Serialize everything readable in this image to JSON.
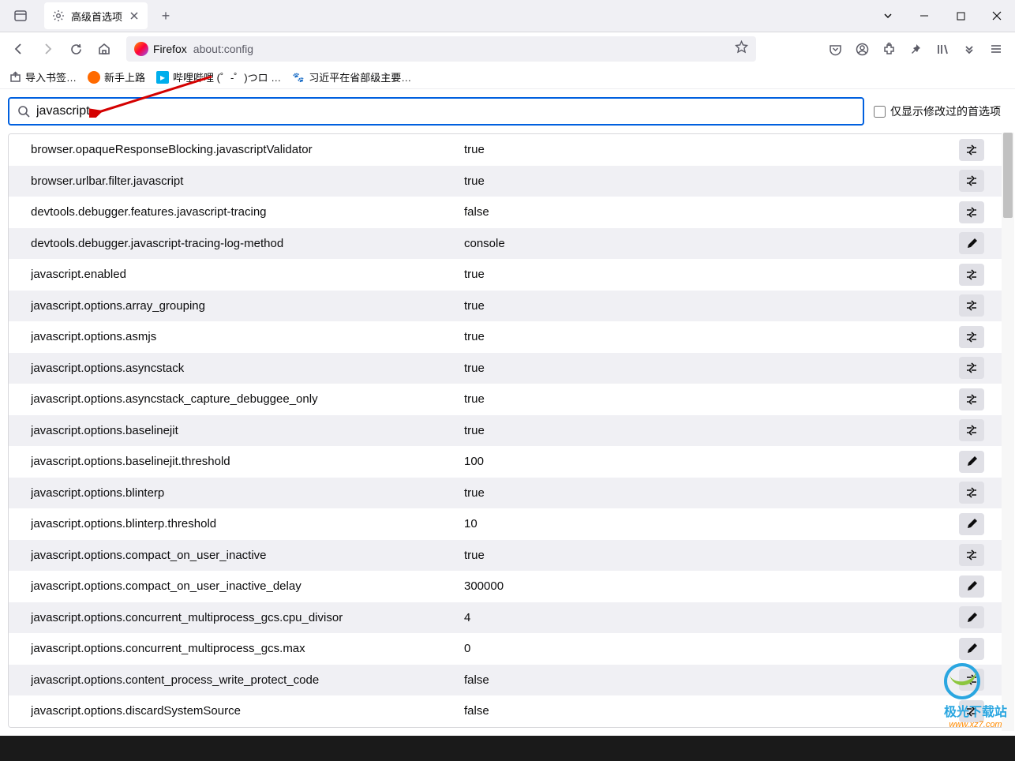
{
  "tab_title": "高级首选项",
  "urlbar_identity": "Firefox",
  "urlbar_url": "about:config",
  "bookmarks": [
    {
      "label": "导入书签…",
      "icon": "import"
    },
    {
      "label": "新手上路",
      "icon": "orange"
    },
    {
      "label": "哔哩哔哩 (゜-゜)つロ …",
      "icon": "cyan"
    },
    {
      "label": "习近平在省部级主要…",
      "icon": "paw"
    }
  ],
  "search_value": "javascript",
  "filter_label": "仅显示修改过的首选项",
  "prefs": [
    {
      "name": "browser.opaqueResponseBlocking.javascriptValidator",
      "value": "true",
      "action": "toggle"
    },
    {
      "name": "browser.urlbar.filter.javascript",
      "value": "true",
      "action": "toggle"
    },
    {
      "name": "devtools.debugger.features.javascript-tracing",
      "value": "false",
      "action": "toggle"
    },
    {
      "name": "devtools.debugger.javascript-tracing-log-method",
      "value": "console",
      "action": "edit"
    },
    {
      "name": "javascript.enabled",
      "value": "true",
      "action": "toggle"
    },
    {
      "name": "javascript.options.array_grouping",
      "value": "true",
      "action": "toggle"
    },
    {
      "name": "javascript.options.asmjs",
      "value": "true",
      "action": "toggle"
    },
    {
      "name": "javascript.options.asyncstack",
      "value": "true",
      "action": "toggle"
    },
    {
      "name": "javascript.options.asyncstack_capture_debuggee_only",
      "value": "true",
      "action": "toggle"
    },
    {
      "name": "javascript.options.baselinejit",
      "value": "true",
      "action": "toggle"
    },
    {
      "name": "javascript.options.baselinejit.threshold",
      "value": "100",
      "action": "edit"
    },
    {
      "name": "javascript.options.blinterp",
      "value": "true",
      "action": "toggle"
    },
    {
      "name": "javascript.options.blinterp.threshold",
      "value": "10",
      "action": "edit"
    },
    {
      "name": "javascript.options.compact_on_user_inactive",
      "value": "true",
      "action": "toggle"
    },
    {
      "name": "javascript.options.compact_on_user_inactive_delay",
      "value": "300000",
      "action": "edit"
    },
    {
      "name": "javascript.options.concurrent_multiprocess_gcs.cpu_divisor",
      "value": "4",
      "action": "edit"
    },
    {
      "name": "javascript.options.concurrent_multiprocess_gcs.max",
      "value": "0",
      "action": "edit"
    },
    {
      "name": "javascript.options.content_process_write_protect_code",
      "value": "false",
      "action": "toggle"
    },
    {
      "name": "javascript.options.discardSystemSource",
      "value": "false",
      "action": "toggle"
    }
  ],
  "watermark_text": "极光下载站",
  "watermark_site": "www.xz7.com"
}
